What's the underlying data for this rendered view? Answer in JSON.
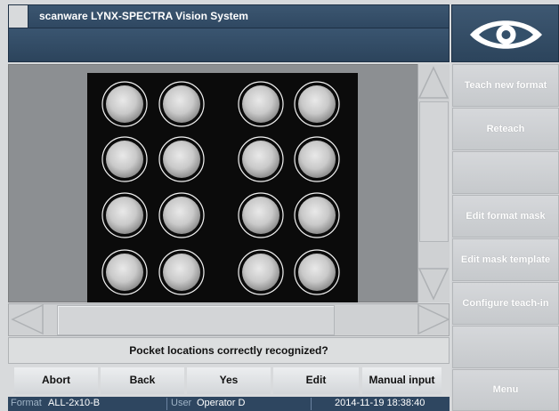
{
  "app": {
    "title": "scanware LYNX-SPECTRA Vision System"
  },
  "message": "Pocket locations correctly recognized?",
  "buttons": {
    "abort": "Abort",
    "back": "Back",
    "yes": "Yes",
    "edit": "Edit",
    "manual_input": "Manual input"
  },
  "status": {
    "format_label": "Format",
    "format_value": "ALL-2x10-B",
    "user_label": "User",
    "user_value": "Operator D",
    "datetime": "2014-11-19 18:38:40"
  },
  "side_menu": {
    "teach_new_format": "Teach new format",
    "reteach": "Reteach",
    "empty1": "",
    "edit_format_mask": "Edit format mask",
    "edit_mask_template": "Edit mask template",
    "configure_teach_in": "Configure teach-in",
    "empty2": "",
    "menu": "Menu"
  },
  "pockets": {
    "rows": 4,
    "cols": 4,
    "count": 16
  },
  "icons": {
    "logo": "eye-logo-icon"
  },
  "colors": {
    "title_bar": "#2f4862",
    "accent_text": "#ffffff"
  }
}
